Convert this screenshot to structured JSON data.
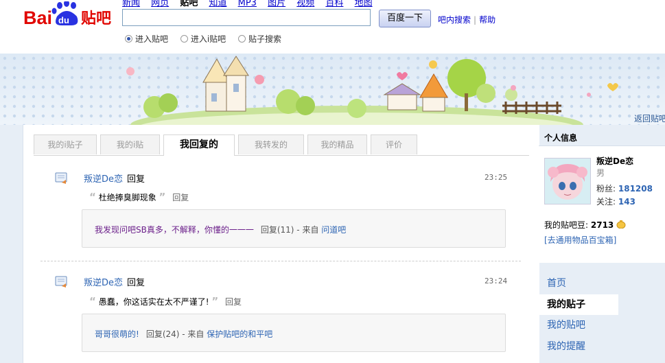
{
  "logo": {
    "bai": "Bai",
    "du": "du",
    "tieba": "贴吧"
  },
  "topnav": {
    "items": [
      "新闻",
      "网页",
      "贴吧",
      "知道",
      "MP3",
      "图片",
      "视频",
      "百科",
      "地图"
    ],
    "current_index": 2
  },
  "search": {
    "value": "",
    "button_label": "百度一下",
    "inbar_search": "吧内搜索",
    "sep": "|",
    "help": "帮助"
  },
  "radios": [
    {
      "label": "进入贴吧",
      "checked": true
    },
    {
      "label": "进入i贴吧",
      "checked": false
    },
    {
      "label": "贴子搜索",
      "checked": false
    }
  ],
  "banner": {
    "back_link": "返回贴吧"
  },
  "tabs": [
    {
      "label": "我的i贴子",
      "active": false
    },
    {
      "label": "我的i贴",
      "active": false
    },
    {
      "label": "我回复的",
      "active": true
    },
    {
      "label": "我转发的",
      "active": false
    },
    {
      "label": "我的精品",
      "active": false
    },
    {
      "label": "评价",
      "active": false
    }
  ],
  "posts": [
    {
      "user": "叛逆De恋",
      "action": "回复",
      "time": "23:25",
      "quote_text": "杜绝捧臭脚现象",
      "quote_reply": "回复",
      "orig_title": "我发现问吧SB真多，不解释，你懂的一一一",
      "orig_meta": "回复(11) - 来自",
      "orig_bar": "问道吧"
    },
    {
      "user": "叛逆De恋",
      "action": "回复",
      "time": "23:24",
      "quote_text": "愚蠢，你这话实在太不严谨了!",
      "quote_reply": "回复",
      "orig_title": "哥哥很萌的!",
      "orig_meta": "回复(24) - 来自",
      "orig_bar": "保护贴吧的和平吧"
    }
  ],
  "quote_marks": {
    "open": "“",
    "close": "”"
  },
  "sidebar": {
    "title": "个人信息",
    "username": "叛逆De恋",
    "sex": "男",
    "fans_label": "粉丝:",
    "fans": "181208",
    "follow_label": "关注:",
    "follow": "143",
    "beans_label": "我的贴吧豆:",
    "beans": "2713",
    "treasure": "[去通用物品百宝箱]",
    "nav": [
      {
        "label": "首页",
        "active": false
      },
      {
        "label": "我的贴子",
        "active": true
      },
      {
        "label": "我的贴吧",
        "active": false
      },
      {
        "label": "我的提醒",
        "active": false
      }
    ]
  },
  "colors": {
    "link": "#2d64b3",
    "purple_title": "#6b1f8a",
    "banner_bg": "#dde9f5",
    "page_bg": "#e7eef6"
  }
}
